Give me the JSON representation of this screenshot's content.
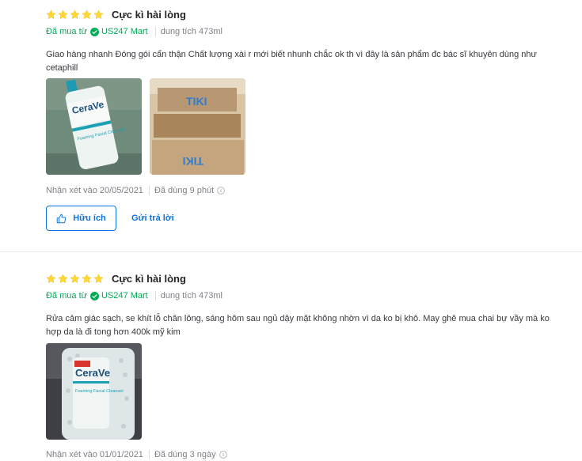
{
  "colors": {
    "star": "#fdd836",
    "verified_green": "#00ab56",
    "link_blue": "#0b74e5",
    "muted_text": "#808089"
  },
  "reviews": [
    {
      "stars": 5,
      "title": "Cực kì hài lòng",
      "bought_label": "Đã mua từ",
      "seller": "US247 Mart",
      "variant": "dung tích 473ml",
      "content": "Giao hàng nhanh Đóng gói cẩn thận Chất lượng xài r mới biết nhunh chắc ok th vì đây là sản phẩm đc bác sĩ khuyên dùng như cetaphill",
      "photos": [
        {
          "brand": "CeraVe",
          "product": "Foaming Facial Cleanser"
        },
        {
          "brand": "TIKI"
        }
      ],
      "date_text": "Nhận xét vào 20/05/2021",
      "used_text": "Đã dùng 9 phút",
      "helpful_label": "Hữu ích",
      "reply_label": "Gửi trả lời"
    },
    {
      "stars": 5,
      "title": "Cực kì hài lòng",
      "bought_label": "Đã mua từ",
      "seller": "US247 Mart",
      "variant": "dung tích 473ml",
      "content": "Rửa cảm giác sạch, se khít lỗ chân lông, sáng hôm sau ngủ dậy mặt không nhờn vì da ko bị khô. May ghê mua chai bự vầy mà ko hợp da là đi tong hơn 400k mỹ kim",
      "photos": [
        {
          "brand": "CeraVe",
          "product": "Foaming Facial Cleanser"
        }
      ],
      "date_text": "Nhận xét vào 01/01/2021",
      "used_text": "Đã dùng 3 ngày"
    }
  ]
}
